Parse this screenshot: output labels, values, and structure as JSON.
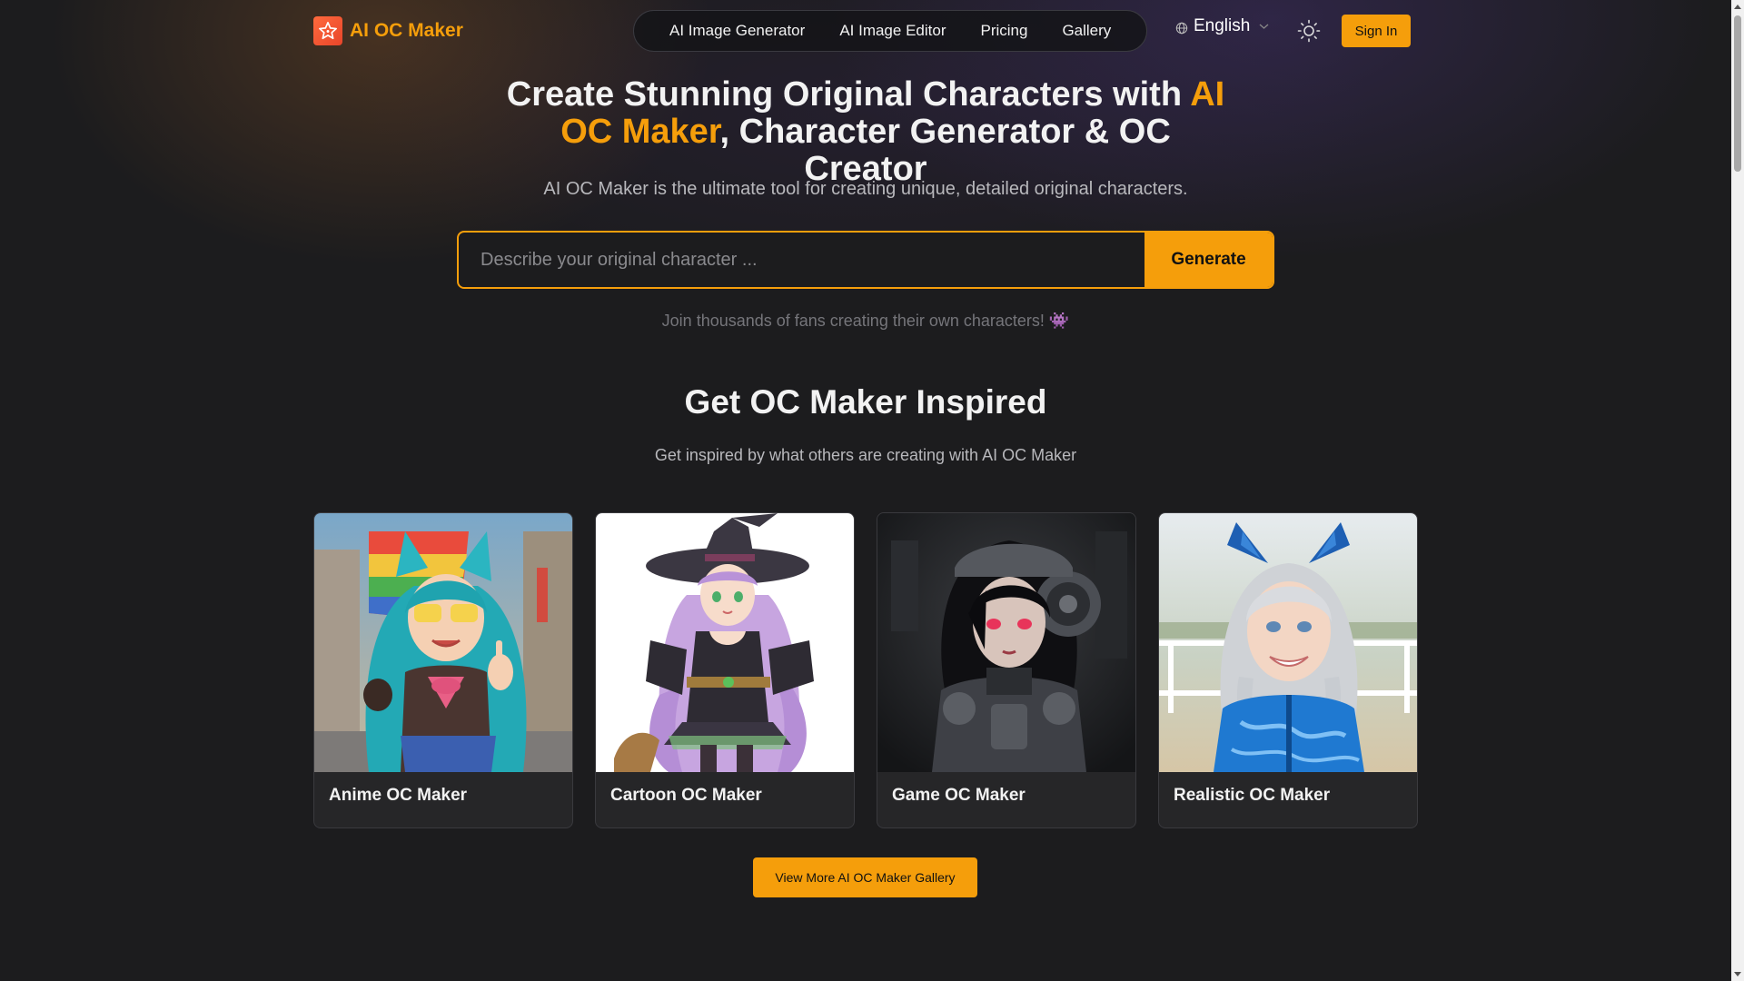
{
  "header": {
    "brand": "AI OC Maker",
    "nav": [
      {
        "label": "AI Image Generator"
      },
      {
        "label": "AI Image Editor"
      },
      {
        "label": "Pricing"
      },
      {
        "label": "Gallery"
      }
    ],
    "language": "English",
    "signin_label": "Sign In"
  },
  "hero": {
    "title_part1": "Create Stunning Original Characters with ",
    "title_accent": "AI OC Maker",
    "title_part2": ", Character Generator & OC Creator",
    "subtitle": "AI OC Maker is the ultimate tool for creating unique, detailed original characters.",
    "prompt_placeholder": "Describe your original character ...",
    "prompt_value": "",
    "generate_label": "Generate",
    "join_text": "Join thousands of fans creating their own characters! 👾"
  },
  "inspired": {
    "title": "Get OC Maker Inspired",
    "subtitle": "Get inspired by what others are creating with AI OC Maker",
    "cards": [
      {
        "label": "Anime OC Maker",
        "image": "anime-character-thumbnail"
      },
      {
        "label": "Cartoon OC Maker",
        "image": "cartoon-witch-thumbnail"
      },
      {
        "label": "Game OC Maker",
        "image": "game-cyborg-thumbnail"
      },
      {
        "label": "Realistic OC Maker",
        "image": "realistic-girl-thumbnail"
      }
    ],
    "gallery_button": "View More AI OC Maker Gallery"
  },
  "colors": {
    "accent": "#f59e0b",
    "background": "#1c1c1e",
    "card": "#262628"
  },
  "icons": [
    "star-logo-icon",
    "globe-icon",
    "chevron-down-icon",
    "sun-icon"
  ]
}
